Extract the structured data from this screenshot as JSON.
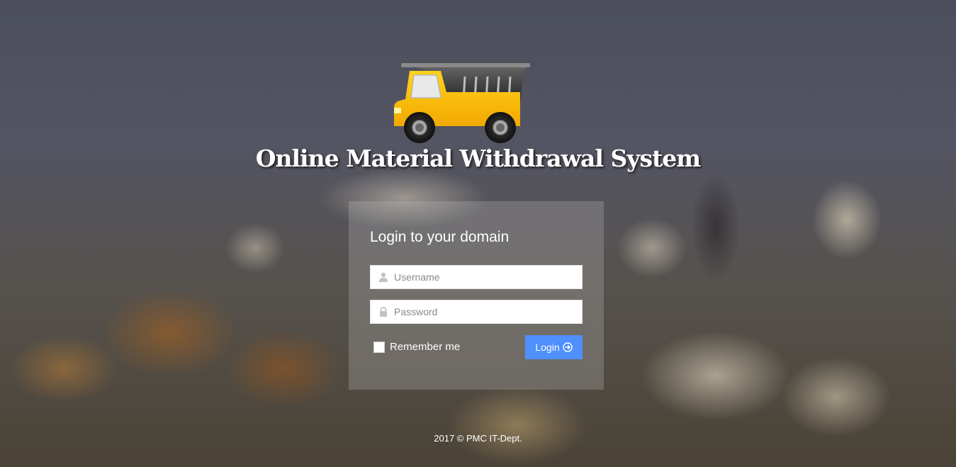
{
  "header": {
    "logo_icon": "dump-truck-icon",
    "title": "Online Material Withdrawal System"
  },
  "login_panel": {
    "title": "Login to your domain",
    "username": {
      "icon": "user-icon",
      "placeholder": "Username",
      "value": ""
    },
    "password": {
      "icon": "lock-icon",
      "placeholder": "Password",
      "value": ""
    },
    "remember_me": {
      "label": "Remember me",
      "checked": false
    },
    "login_button": {
      "label": "Login",
      "icon": "arrow-circle-right-icon",
      "color": "#4d90fe"
    }
  },
  "footer": {
    "text": "2017 © PMC IT-Dept."
  }
}
